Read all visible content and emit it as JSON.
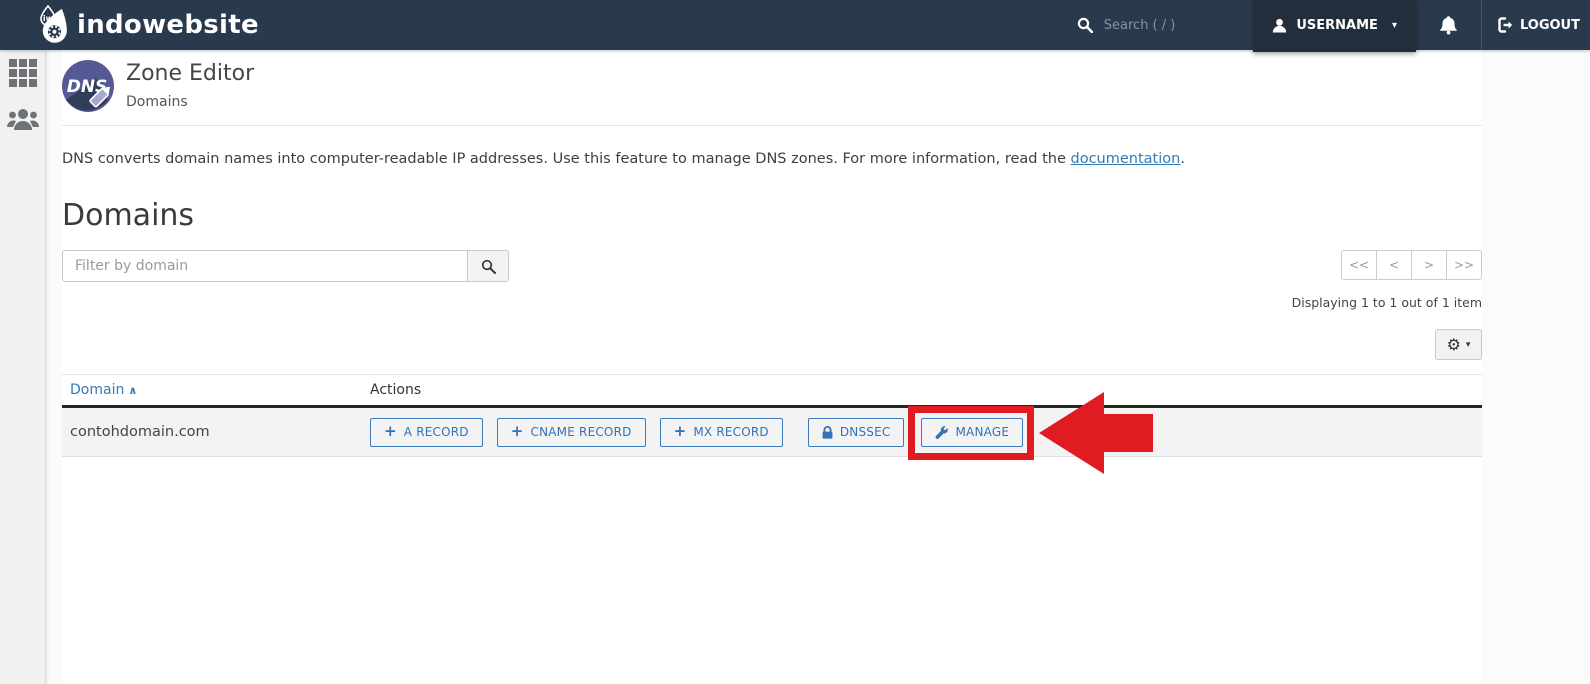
{
  "colors": {
    "navbar": "#2a3a4d",
    "accent_blue": "#337ab7",
    "highlight_red": "#e11b22",
    "sidebar_bg": "#f1f1f2"
  },
  "nav": {
    "brand": "indowebsite",
    "search_placeholder": "Search ( / )",
    "username": "USERNAME",
    "caret_glyph": "▾",
    "logout_label": "LOGOUT"
  },
  "page_header": {
    "title": "Zone Editor",
    "breadcrumb": "Domains",
    "badge_text": "DNS"
  },
  "intro": {
    "text": "DNS converts domain names into computer-readable IP addresses. Use this feature to manage DNS zones. For more information, read the ",
    "link_label": "documentation",
    "suffix": "."
  },
  "domains": {
    "heading": "Domains",
    "filter_placeholder": "Filter by domain",
    "pager": {
      "first": "<<",
      "prev": "<",
      "next": ">",
      "last": ">>"
    },
    "status": "Displaying 1 to 1 out of 1 item",
    "settings_glyph": "⚙",
    "settings_caret": "▾"
  },
  "table": {
    "col_domain": "Domain",
    "sort_glyph": "∧",
    "col_actions": "Actions",
    "rows": [
      {
        "domain": "contohdomain.com",
        "actions": [
          {
            "icon": "plus-icon",
            "glyph": "+",
            "label": "A RECORD"
          },
          {
            "icon": "plus-icon",
            "glyph": "+",
            "label": "CNAME RECORD"
          },
          {
            "icon": "plus-icon",
            "glyph": "+",
            "label": "MX RECORD"
          },
          {
            "icon": "lock-icon",
            "label": "DNSSEC"
          },
          {
            "icon": "wrench-icon",
            "label": "MANAGE",
            "highlighted": true
          }
        ]
      }
    ]
  }
}
